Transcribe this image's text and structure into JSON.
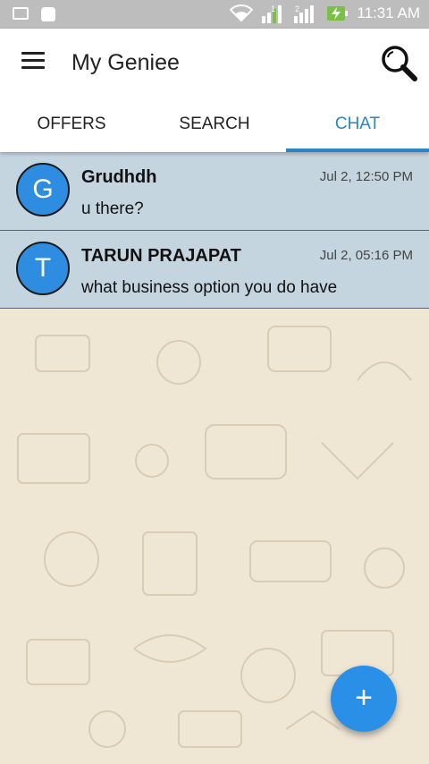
{
  "status_bar": {
    "time": "11:31 AM",
    "sim1_label": "1",
    "sim2_label": "2",
    "icons": [
      "image-icon",
      "android-icon",
      "wifi-icon",
      "signal-sim1-icon",
      "signal-sim2-icon",
      "battery-charging-icon"
    ]
  },
  "app_bar": {
    "title": "My Geniee",
    "menu_icon": "hamburger-menu-icon",
    "search_icon": "search-icon"
  },
  "tabs": [
    {
      "label": "OFFERS",
      "active": false
    },
    {
      "label": "SEARCH",
      "active": false
    },
    {
      "label": "CHAT",
      "active": true
    }
  ],
  "chats": [
    {
      "initial": "G",
      "name": "Grudhdh",
      "time": "Jul 2, 12:50 PM",
      "message": "u there?"
    },
    {
      "initial": "T",
      "name": "TARUN PRAJAPAT",
      "time": "Jul 2, 05:16 PM",
      "message": "what business option you do have"
    }
  ],
  "fab": {
    "label": "+",
    "icon": "add-icon"
  },
  "colors": {
    "accent": "#2a86c7",
    "avatar": "#2e8de0",
    "chat_row_bg": "#c5d5e0",
    "background": "#efe6d4",
    "status_bar": "#bdbdbd"
  }
}
